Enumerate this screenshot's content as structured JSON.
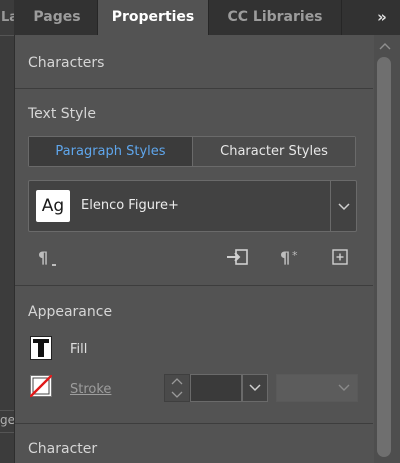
{
  "left_strip": {
    "top_fragment": "La",
    "bottom_fragment": "ge"
  },
  "tabs": [
    {
      "label": "Pages",
      "active": false
    },
    {
      "label": "Properties",
      "active": true
    },
    {
      "label": "CC Libraries",
      "active": false
    }
  ],
  "tab_overflow_icon": "double-chevron-right-icon",
  "sections": {
    "characters": "Characters",
    "text_style": "Text Style",
    "appearance": "Appearance",
    "character": "Character"
  },
  "text_style": {
    "segments": [
      {
        "label": "Paragraph Styles",
        "selected": true
      },
      {
        "label": "Character Styles",
        "selected": false
      }
    ],
    "preview_glyph": "Ag",
    "selected_style": "Elenco Figure+"
  },
  "appearance": {
    "fill_label": "Fill",
    "stroke_label": "Stroke",
    "stroke_weight": ""
  },
  "colors": {
    "panel": "#535353",
    "accent": "#5fa6ec",
    "tab_bar": "#323232"
  }
}
